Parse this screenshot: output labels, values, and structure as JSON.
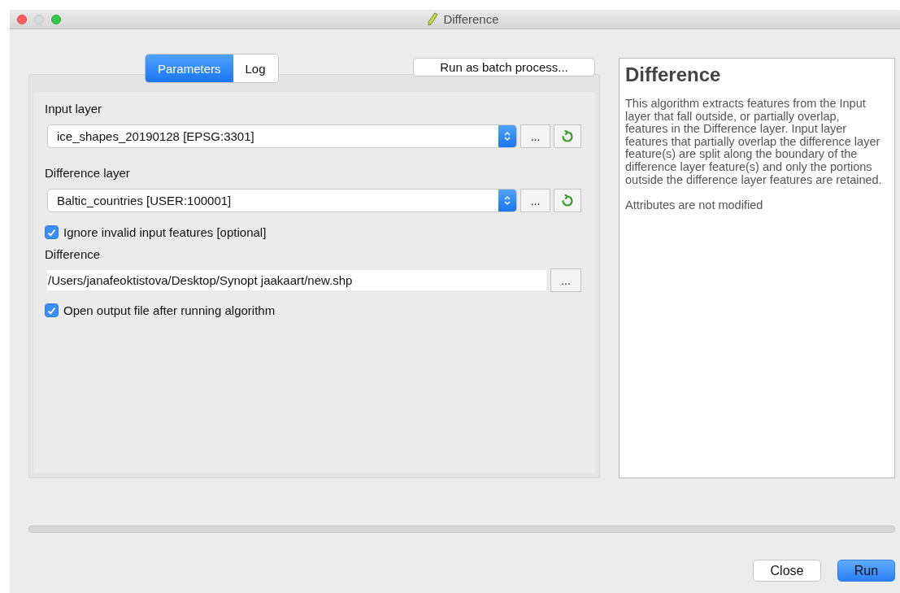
{
  "window": {
    "title": "Difference"
  },
  "tabs": [
    {
      "label": "Parameters",
      "selected": true
    },
    {
      "label": "Log",
      "selected": false
    }
  ],
  "batch_button": "Run as batch process...",
  "parameters": [
    {
      "kind": "layer",
      "label": "Input layer",
      "value": "ice_shapes_20190128 [EPSG:3301]",
      "browse": "..."
    },
    {
      "kind": "layer",
      "label": "Difference layer",
      "value": "Baltic_countries [USER:100001]",
      "browse": "..."
    },
    {
      "kind": "checkbox",
      "label": "Ignore invalid input features [optional]",
      "checked": true
    },
    {
      "kind": "file",
      "label": "Difference",
      "value": "/Users/janafeoktistova/Desktop/Synopt jaakaart/new.shp",
      "browse": "..."
    },
    {
      "kind": "checkbox",
      "label": "Open output file after running algorithm",
      "checked": true
    }
  ],
  "help": {
    "title": "Difference",
    "paragraphs": [
      "This algorithm extracts features from the Input layer that fall outside, or partially overlap, features in the Difference layer. Input layer features that partially overlap the difference layer feature(s) are split along the boundary of the difference layer feature(s) and only the portions outside the difference layer features are retained.",
      "Attributes are not modified"
    ]
  },
  "buttons": [
    {
      "label": "Close",
      "primary": false
    },
    {
      "label": "Run",
      "primary": true
    }
  ]
}
